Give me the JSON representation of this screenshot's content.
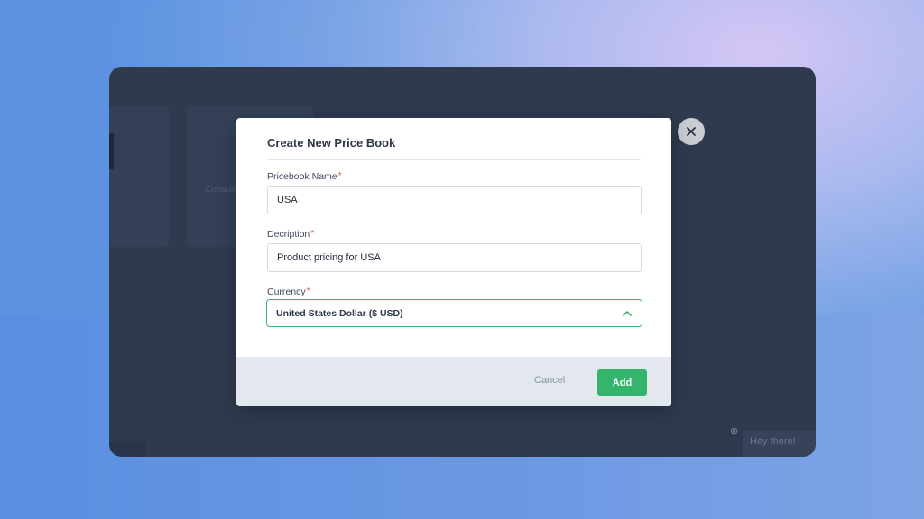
{
  "background_app": {
    "ghost_label": "Consult",
    "chat_text": "Hey there!"
  },
  "modal": {
    "title": "Create New Price Book",
    "required_mark": "*",
    "fields": {
      "name": {
        "label": "Pricebook Name",
        "value": "USA"
      },
      "description": {
        "label": "Decription",
        "value": "Product pricing for USA"
      },
      "currency": {
        "label": "Currency",
        "selected": "United States Dollar ($ USD)"
      }
    },
    "cancel_label": "Cancel",
    "add_label": "Add",
    "close_icon": "close-icon"
  },
  "colors": {
    "primary_green": "#35b56b",
    "required_red": "#e8553e",
    "overlay": "#2f3a4f"
  }
}
